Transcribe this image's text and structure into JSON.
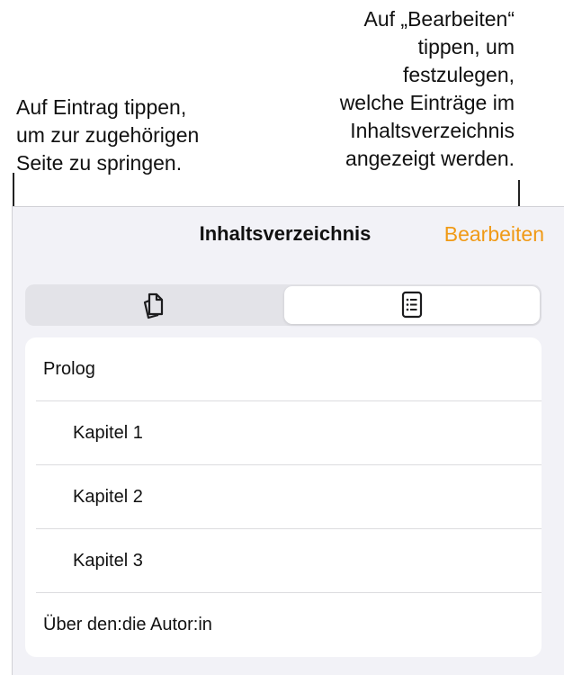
{
  "callouts": {
    "left": {
      "line1": "Auf Eintrag tippen,",
      "line2": "um zur zugehörigen",
      "line3": "Seite zu springen."
    },
    "right": {
      "line1": "Auf „Bearbeiten“",
      "line2": "tippen, um",
      "line3": "festzulegen,",
      "line4": "welche Einträge im",
      "line5": "Inhaltsverzeichnis",
      "line6": "angezeigt werden."
    }
  },
  "sheet": {
    "title": "Inhaltsverzeichnis",
    "edit_label": "Bearbeiten",
    "accent_color": "#f09a16",
    "segments": [
      {
        "icon": "page-thumbnails-icon",
        "selected": false
      },
      {
        "icon": "table-of-contents-icon",
        "selected": true
      }
    ],
    "entries": [
      {
        "label": "Prolog",
        "level": 0
      },
      {
        "label": "Kapitel 1",
        "level": 1
      },
      {
        "label": "Kapitel 2",
        "level": 1
      },
      {
        "label": "Kapitel 3",
        "level": 1
      },
      {
        "label": "Über den:die Autor:in",
        "level": 0
      }
    ]
  }
}
